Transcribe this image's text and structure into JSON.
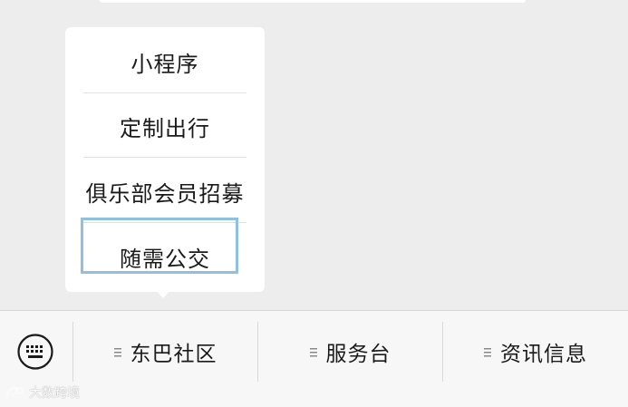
{
  "popup_menu": {
    "items": [
      {
        "label": "小程序"
      },
      {
        "label": "定制出行"
      },
      {
        "label": "俱乐部会员招募"
      },
      {
        "label": "随需公交"
      }
    ],
    "highlighted_index": 3,
    "highlight_color": "#8fc0e4"
  },
  "bottom_bar": {
    "keyboard_icon": "keyboard-icon",
    "tabs": [
      {
        "label": "东巴社区",
        "icon": "menu-lines-icon"
      },
      {
        "label": "服务台",
        "icon": "menu-lines-icon"
      },
      {
        "label": "资讯信息",
        "icon": "menu-lines-icon"
      }
    ]
  },
  "watermark": {
    "text": "大数跨境"
  },
  "colors": {
    "background": "#ededed",
    "menu_bg": "#ffffff",
    "bar_bg": "#f7f7f7",
    "text": "#1a1a1a"
  }
}
